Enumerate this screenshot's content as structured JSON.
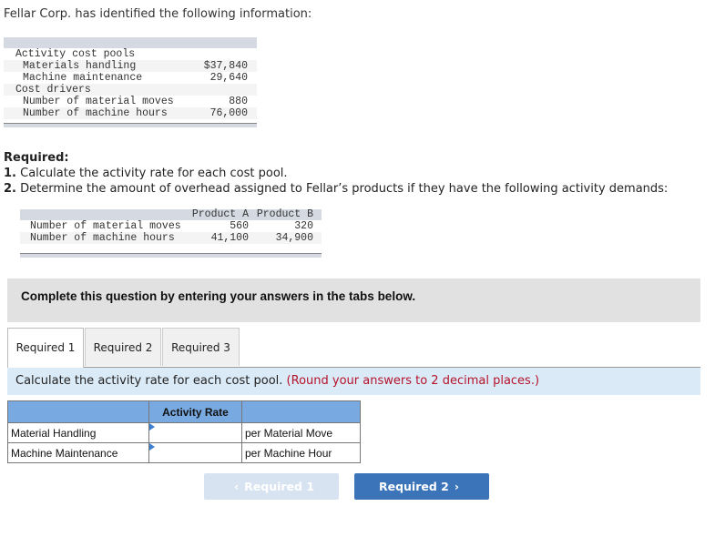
{
  "intro": "Fellar Corp. has identified the following information:",
  "info_table": {
    "rows": [
      {
        "label": "Activity cost pools",
        "value": "",
        "indent": false
      },
      {
        "label": "Materials handling",
        "value": "$37,840",
        "indent": true
      },
      {
        "label": "Machine maintenance",
        "value": "29,640",
        "indent": true
      },
      {
        "label": "Cost drivers",
        "value": "",
        "indent": false
      },
      {
        "label": "Number of material moves",
        "value": "880",
        "indent": true
      },
      {
        "label": "Number of machine hours",
        "value": "76,000",
        "indent": true
      }
    ]
  },
  "required": {
    "heading": "Required:",
    "items": [
      {
        "num": "1.",
        "text": "Calculate the activity rate for each cost pool."
      },
      {
        "num": "2.",
        "text": "Determine the amount of overhead assigned to Fellar’s products if they have the following activity demands:"
      }
    ]
  },
  "demand_table": {
    "headers": [
      "",
      "Product A",
      "Product B"
    ],
    "rows": [
      {
        "label": "Number of material moves",
        "a": "560",
        "b": "320"
      },
      {
        "label": "Number of machine hours",
        "a": "41,100",
        "b": "34,900"
      }
    ]
  },
  "instructions": "Complete this question by entering your answers in the tabs below.",
  "tabs": [
    {
      "label": "Required 1",
      "active": true
    },
    {
      "label": "Required 2",
      "active": false
    },
    {
      "label": "Required 3",
      "active": false
    }
  ],
  "prompt": {
    "text": "Calculate the activity rate for each cost pool.",
    "note": "(Round your answers to 2 decimal places.)"
  },
  "answer_table": {
    "header": "Activity Rate",
    "rows": [
      {
        "label": "Material Handling",
        "value": "",
        "unit": "per Material Move"
      },
      {
        "label": "Machine Maintenance",
        "value": "",
        "unit": "per Machine Hour"
      }
    ]
  },
  "nav": {
    "prev_label": "Required 1",
    "next_label": "Required 2",
    "prev_icon": "chevron-left-icon",
    "next_icon": "chevron-right-icon"
  },
  "colors": {
    "accent": "#3b74b9",
    "table_header": "#78a9e1",
    "note_red": "#b5132b",
    "prompt_bg": "#dbeaf7"
  }
}
